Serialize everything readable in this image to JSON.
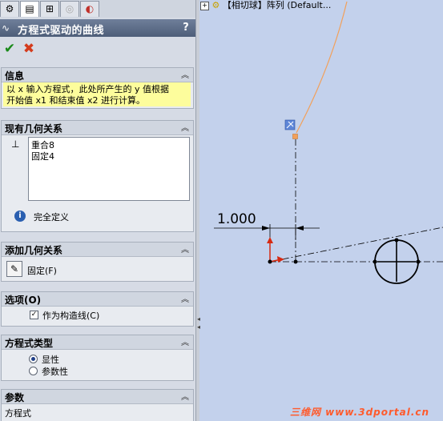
{
  "header": {
    "title": "方程式驱动的曲线",
    "help": "?"
  },
  "tabs": [
    "feature-manager",
    "property-manager",
    "configuration-manager",
    "dimxpert",
    "display-manager"
  ],
  "actions": {
    "ok": "✔",
    "cancel": "✖"
  },
  "info": {
    "title": "信息",
    "text_line1": "以 x 输入方程式，此处所产生的 y 值根据",
    "text_line2": "开始值 x1 和结束值 x2 进行计算。"
  },
  "existing_relations": {
    "title": "现有几何关系",
    "items": [
      "重合8",
      "固定4"
    ],
    "status": "完全定义"
  },
  "add_relations": {
    "title": "添加几何关系",
    "fix_label": "固定(F)"
  },
  "options": {
    "title": "选项(O)",
    "construction_label": "作为构造线(C)",
    "construction_checked": true
  },
  "equation_type": {
    "title": "方程式类型",
    "options": [
      "显性",
      "参数性"
    ],
    "selected": "显性"
  },
  "parameters": {
    "title": "参数",
    "equation_label": "方程式"
  },
  "tree": {
    "label": "【相切球】阵列  (Default..."
  },
  "canvas": {
    "dimension_value": "1.000"
  },
  "watermark": "三维网 www.3dportal.cn",
  "colors": {
    "viewport_bg": "#c3d1ec",
    "curve": "#f2a05a",
    "info_bg": "#fdfd9c",
    "header_bg": "#5d6d88"
  }
}
